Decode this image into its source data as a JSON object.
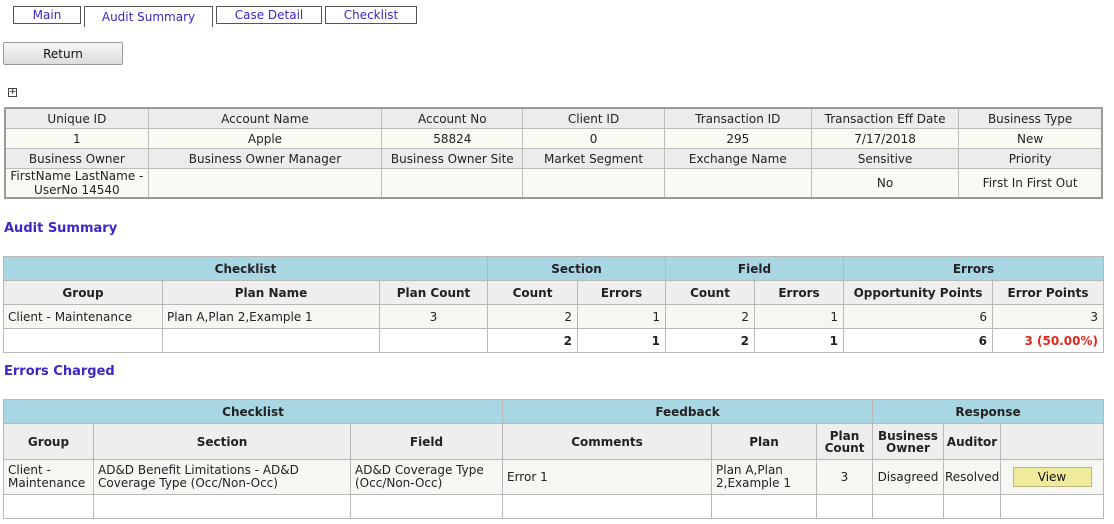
{
  "tabs": [
    {
      "label": "Main"
    },
    {
      "label": "Audit Summary"
    },
    {
      "label": "Case Detail"
    },
    {
      "label": "Checklist"
    }
  ],
  "return_label": "Return",
  "expand_symbol": "+",
  "case_info": {
    "headers1": [
      "Unique ID",
      "Account Name",
      "Account No",
      "Client ID",
      "Transaction ID",
      "Transaction Eff Date",
      "Business Type"
    ],
    "values1": [
      "1",
      "Apple",
      "58824",
      "0",
      "295",
      "7/17/2018",
      "New"
    ],
    "headers2": [
      "Business Owner",
      "Business Owner Manager",
      "Business Owner Site",
      "Market Segment",
      "Exchange Name",
      "Sensitive",
      "Priority"
    ],
    "values2": [
      "FirstName LastName - UserNo 14540",
      "",
      "",
      "",
      "",
      "No",
      "First In First Out"
    ]
  },
  "audit_summary": {
    "title": "Audit Summary",
    "groups": [
      "Checklist",
      "Section",
      "Field",
      "Errors"
    ],
    "columns": [
      "Group",
      "Plan Name",
      "Plan Count",
      "Count",
      "Errors",
      "Count",
      "Errors",
      "Opportunity Points",
      "Error Points"
    ],
    "row": [
      "Client - Maintenance",
      "Plan A,Plan 2,Example 1",
      "3",
      "2",
      "1",
      "2",
      "1",
      "6",
      "3"
    ],
    "totals": [
      "",
      "",
      "",
      "2",
      "1",
      "2",
      "1",
      "6",
      "3 (50.00%)"
    ]
  },
  "errors_charged": {
    "title": "Errors Charged",
    "groups": [
      "Checklist",
      "Feedback",
      "Response"
    ],
    "columns": [
      "Group",
      "Section",
      "Field",
      "Comments",
      "Plan",
      "Plan Count",
      "Business Owner",
      "Auditor",
      ""
    ],
    "row": [
      "Client - Maintenance",
      "AD&D Benefit Limitations - AD&D Coverage Type (Occ/Non-Occ)",
      "AD&D Coverage Type (Occ/Non-Occ)",
      "Error 1",
      "Plan A,Plan 2,Example 1",
      "3",
      "Disagreed",
      "Resolved"
    ],
    "view_label": "View"
  }
}
